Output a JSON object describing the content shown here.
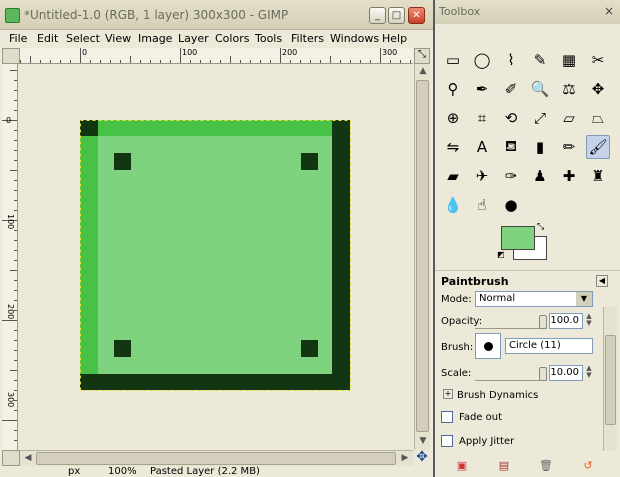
{
  "image_window": {
    "title": "*Untitled-1.0 (RGB, 1 layer) 300x300 - GIMP",
    "menu": [
      "File",
      "Edit",
      "Select",
      "View",
      "Image",
      "Layer",
      "Colors",
      "Tools",
      "Filters",
      "Windows",
      "Help"
    ],
    "ruler_top_labels": [
      "0",
      "100",
      "200",
      "300"
    ],
    "ruler_left_labels": [
      "0",
      "100",
      "200",
      "300"
    ],
    "status_left": "px",
    "status_zoom": "100%",
    "status_text": "Pasted Layer (2.2 MB)",
    "canvas_colors": {
      "fill": "#7fd37f",
      "highlight": "#47c247",
      "shadow": "#123612"
    }
  },
  "toolbox": {
    "title": "Toolbox",
    "close_glyph": "×",
    "tools": [
      {
        "name": "rect-select-icon",
        "glyph": "▭"
      },
      {
        "name": "ellipse-select-icon",
        "glyph": "◯"
      },
      {
        "name": "free-select-icon",
        "glyph": "⌇"
      },
      {
        "name": "fuzzy-select-icon",
        "glyph": "✎"
      },
      {
        "name": "color-select-icon",
        "glyph": "▦"
      },
      {
        "name": "scissors-icon",
        "glyph": "✂"
      },
      {
        "name": "foreground-select-icon",
        "glyph": "⚲"
      },
      {
        "name": "paths-icon",
        "glyph": "✒"
      },
      {
        "name": "color-picker-icon",
        "glyph": "✐"
      },
      {
        "name": "zoom-icon",
        "glyph": "🔍"
      },
      {
        "name": "measure-icon",
        "glyph": "⚖"
      },
      {
        "name": "move-icon",
        "glyph": "✥"
      },
      {
        "name": "align-icon",
        "glyph": "⊕"
      },
      {
        "name": "crop-icon",
        "glyph": "⌗"
      },
      {
        "name": "rotate-icon",
        "glyph": "⟲"
      },
      {
        "name": "scale-icon",
        "glyph": "⤢"
      },
      {
        "name": "shear-icon",
        "glyph": "▱"
      },
      {
        "name": "perspective-icon",
        "glyph": "⏢"
      },
      {
        "name": "flip-icon",
        "glyph": "⇋"
      },
      {
        "name": "text-icon",
        "glyph": "A"
      },
      {
        "name": "bucket-fill-icon",
        "glyph": "⛾"
      },
      {
        "name": "blend-icon",
        "glyph": "▮"
      },
      {
        "name": "pencil-icon",
        "glyph": "✏"
      },
      {
        "name": "paintbrush-icon",
        "glyph": "🖌"
      },
      {
        "name": "eraser-icon",
        "glyph": "▰"
      },
      {
        "name": "airbrush-icon",
        "glyph": "✈"
      },
      {
        "name": "ink-icon",
        "glyph": "✑"
      },
      {
        "name": "clone-icon",
        "glyph": "♟"
      },
      {
        "name": "heal-icon",
        "glyph": "✚"
      },
      {
        "name": "perspective-clone-icon",
        "glyph": "♜"
      },
      {
        "name": "blur-icon",
        "glyph": "💧"
      },
      {
        "name": "smudge-icon",
        "glyph": "☝"
      },
      {
        "name": "dodge-burn-icon",
        "glyph": "●"
      }
    ],
    "options_title": "Paintbrush",
    "mode_label": "Mode:",
    "mode_value": "Normal",
    "opacity_label": "Opacity:",
    "opacity_value": "100.0",
    "opacity_fraction": 1.0,
    "brush_label": "Brush:",
    "brush_value": "Circle (11)",
    "scale_label": "Scale:",
    "scale_value": "10.00",
    "scale_fraction": 1.0,
    "brush_dynamics": "Brush Dynamics",
    "fade_out": "Fade out",
    "apply_jitter": "Apply Jitter",
    "fg_color": "#7fd37f",
    "bg_color": "#ffffff"
  }
}
